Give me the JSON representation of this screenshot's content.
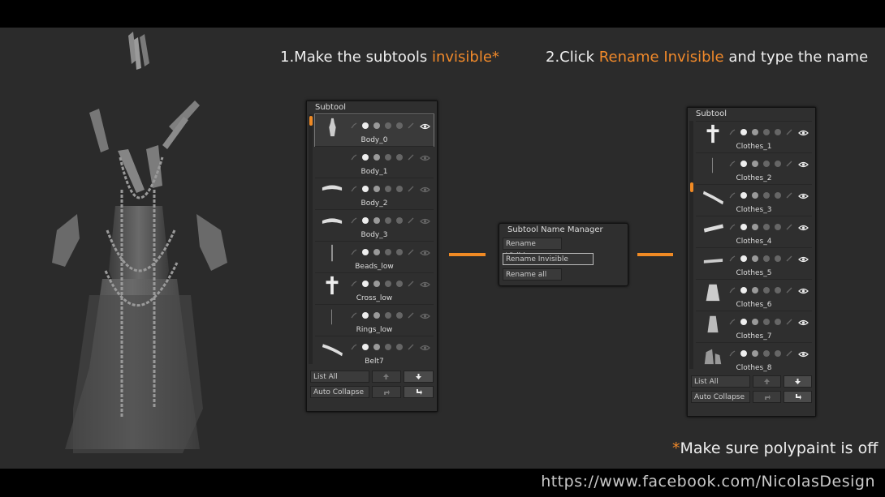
{
  "heading1": {
    "prefix": "1.Make the subtools ",
    "accent": "invisible*"
  },
  "heading2": {
    "prefix": "2.Click ",
    "accent": "Rename Invisible",
    "suffix": " and type the name"
  },
  "note": {
    "accent": "*",
    "text": "Make sure polypaint is off"
  },
  "footer_url": "https://www.facebook.com/NicolasDesign",
  "left_panel": {
    "title": "Subtool",
    "items": [
      "Body_0",
      "Body_1",
      "Body_2",
      "Body_3",
      "Beads_low",
      "Cross_low",
      "Rings_low",
      "Belt7"
    ],
    "list_all": "List All",
    "auto_collapse": "Auto Collapse"
  },
  "dialog": {
    "title": "Subtool Name Manager",
    "rename_visible": "Rename Visible",
    "rename_invisible": "Rename Invisible",
    "rename_all": "Rename all"
  },
  "right_panel": {
    "title": "Subtool",
    "items": [
      "Clothes_1",
      "Clothes_2",
      "Clothes_3",
      "Clothes_4",
      "Clothes_5",
      "Clothes_6",
      "Clothes_7",
      "Clothes_8"
    ],
    "list_all": "List All",
    "auto_collapse": "Auto Collapse"
  },
  "colors": {
    "accent": "#f0892a",
    "panel": "#2f2f2f",
    "stage": "#2b2b2b"
  }
}
